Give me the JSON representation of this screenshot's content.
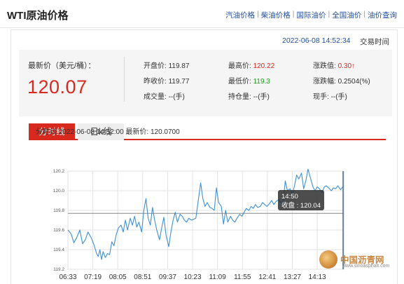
{
  "header": {
    "title": "WTI原油价格",
    "nav": [
      "汽油价格",
      "柴油价格",
      "国际油价",
      "全国油价",
      "油价查询"
    ]
  },
  "timebar": {
    "time": "2022-06-08 14:52:34",
    "label": "交易时间"
  },
  "quote": {
    "last_label": "最新价（美元/桶）：",
    "last_value": "120.07",
    "open_label": "开盘价:",
    "open_value": "119.87",
    "prev_label": "昨收价:",
    "prev_value": "119.77",
    "vol_label": "成交量:",
    "vol_value": "--(手)",
    "high_label": "最高价:",
    "high_value": "120.22",
    "low_label": "最低价:",
    "low_value": "119.3",
    "oi_label": "持仓量:",
    "oi_value": "--(手)",
    "chg_label": "涨跌值:",
    "chg_value": "0.30↑",
    "pct_label": "涨跌幅:",
    "pct_value": "0.2504(%)",
    "hand_label": "现手:",
    "hand_value": "--(手)"
  },
  "tabs": {
    "intraday": "分时线",
    "kline": "日k线"
  },
  "chart_title": "分时线  2022-06-08 14:52:00  最新价: 120.0700",
  "tooltip": {
    "time": "14:50",
    "close_label": "收盘",
    "close_value": "120.04"
  },
  "watermark": {
    "name": "中国沥青网",
    "url": "www.sinoasphalt.com"
  },
  "colors": {
    "line": "#3d8fd5",
    "red": "#d8291f",
    "green": "#17a117",
    "ref": "#888888"
  },
  "chart_data": {
    "type": "line",
    "title": "分时线",
    "ylim": [
      119.2,
      120.2
    ],
    "yticks": [
      "120.2",
      "120.0",
      "119.8",
      "119.6",
      "119.4",
      "119.2"
    ],
    "reference_line": 119.77,
    "xlim_minutes": [
      0,
      509
    ],
    "xticks": [
      {
        "label": "06:33",
        "t": 0
      },
      {
        "label": "07:19",
        "t": 46
      },
      {
        "label": "08:05",
        "t": 92
      },
      {
        "label": "08:51",
        "t": 138
      },
      {
        "label": "09:37",
        "t": 184
      },
      {
        "label": "10:23",
        "t": 230
      },
      {
        "label": "11:09",
        "t": 276
      },
      {
        "label": "11:55",
        "t": 322
      },
      {
        "label": "12:41",
        "t": 368
      },
      {
        "label": "13:27",
        "t": 414
      },
      {
        "label": "14:13",
        "t": 460
      }
    ],
    "series": [
      {
        "t": [
          0,
          6,
          11,
          16,
          22,
          27,
          32,
          37,
          43,
          48,
          53,
          56,
          59,
          62,
          65,
          69,
          73,
          77,
          81,
          85,
          89,
          93,
          98,
          102,
          106,
          110,
          115,
          119,
          123,
          127,
          131,
          136,
          140,
          144,
          148,
          152,
          156,
          160,
          164,
          169,
          173,
          177,
          181,
          186,
          190,
          194,
          198,
          202,
          207,
          211,
          215,
          219,
          223,
          228,
          232,
          236,
          240,
          245,
          249,
          253,
          257,
          262,
          266,
          270,
          274,
          278,
          283,
          287,
          291,
          295,
          300,
          304,
          308,
          312,
          317,
          321,
          325,
          329,
          334,
          338,
          342,
          346,
          350,
          355,
          359,
          363,
          367,
          372,
          376,
          380,
          384,
          389,
          393,
          397,
          401,
          405,
          410,
          414,
          418,
          422,
          426,
          431,
          435,
          439,
          443,
          447,
          452,
          456,
          460,
          464,
          469,
          473,
          477,
          481,
          486,
          490,
          494,
          498,
          503,
          507
        ],
        "values": [
          119.6,
          119.56,
          119.47,
          119.52,
          119.6,
          119.46,
          119.5,
          119.58,
          119.52,
          119.45,
          119.36,
          119.33,
          119.4,
          119.3,
          119.38,
          119.32,
          119.36,
          119.35,
          119.48,
          119.44,
          119.55,
          119.62,
          119.65,
          119.58,
          119.7,
          119.6,
          119.72,
          119.65,
          119.74,
          119.63,
          119.68,
          119.58,
          119.8,
          119.92,
          119.72,
          119.65,
          119.83,
          119.7,
          119.6,
          119.5,
          119.62,
          119.73,
          119.55,
          119.43,
          119.58,
          119.7,
          119.78,
          119.68,
          119.76,
          119.74,
          119.7,
          119.68,
          119.72,
          119.7,
          119.71,
          119.72,
          119.88,
          120.08,
          119.92,
          119.84,
          119.88,
          119.83,
          119.82,
          119.8,
          120.03,
          119.88,
          119.84,
          119.66,
          119.8,
          119.68,
          119.74,
          119.7,
          119.68,
          119.72,
          119.76,
          119.74,
          119.78,
          119.82,
          119.8,
          119.84,
          119.82,
          119.86,
          119.83,
          119.84,
          119.88,
          119.86,
          119.84,
          119.87,
          119.9,
          119.86,
          119.89,
          119.91,
          119.88,
          119.86,
          120.1,
          120.0,
          120.02,
          119.96,
          120.05,
          120.16,
          120.12,
          120.18,
          120.02,
          120.1,
          120.22,
          120.14,
          120.04,
          120.0,
          120.04,
          120.02,
          119.98,
          120.04,
          120.05,
          120.03,
          120.0,
          120.03,
          120.02,
          120.05,
          120.01,
          120.04
        ]
      }
    ]
  }
}
